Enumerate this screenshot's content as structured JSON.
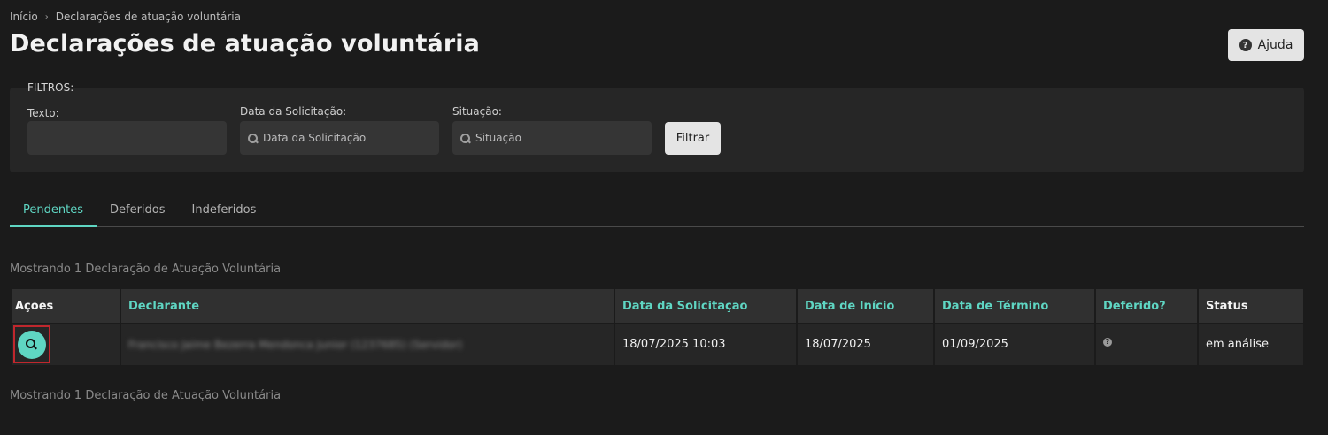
{
  "breadcrumb": {
    "home": "Início",
    "current": "Declarações de atuação voluntária"
  },
  "page_title": "Declarações de atuação voluntária",
  "help_button": {
    "label": "Ajuda",
    "icon": "question-circle-icon"
  },
  "filters": {
    "section_label": "FILTROS:",
    "text_field": {
      "label": "Texto:",
      "value": "",
      "placeholder": ""
    },
    "date_field": {
      "label": "Data da Solicitação:",
      "placeholder": "Data da Solicitação"
    },
    "status_field": {
      "label": "Situação:",
      "placeholder": "Situação"
    },
    "submit_label": "Filtrar"
  },
  "tabs": [
    {
      "label": "Pendentes",
      "active": true
    },
    {
      "label": "Deferidos",
      "active": false
    },
    {
      "label": "Indeferidos",
      "active": false
    }
  ],
  "showing_text": "Mostrando 1 Declaração de Atuação Voluntária",
  "table": {
    "headers": [
      "Ações",
      "Declarante",
      "Data da Solicitação",
      "Data de Início",
      "Data de Término",
      "Deferido?",
      "Status"
    ],
    "rows": [
      {
        "declarante": "Francisco Jaime Bezerra Mendonca Junior (1237685) (Servidor)",
        "data_solicitacao": "18/07/2025 10:03",
        "data_inicio": "18/07/2025",
        "data_termino": "01/09/2025",
        "deferido_icon": "question-circle-icon",
        "status": "em análise"
      }
    ]
  },
  "colors": {
    "accent": "#5fd6c3",
    "background": "#1b1b1b",
    "panel": "#262626",
    "highlight_border": "#c0272d"
  }
}
